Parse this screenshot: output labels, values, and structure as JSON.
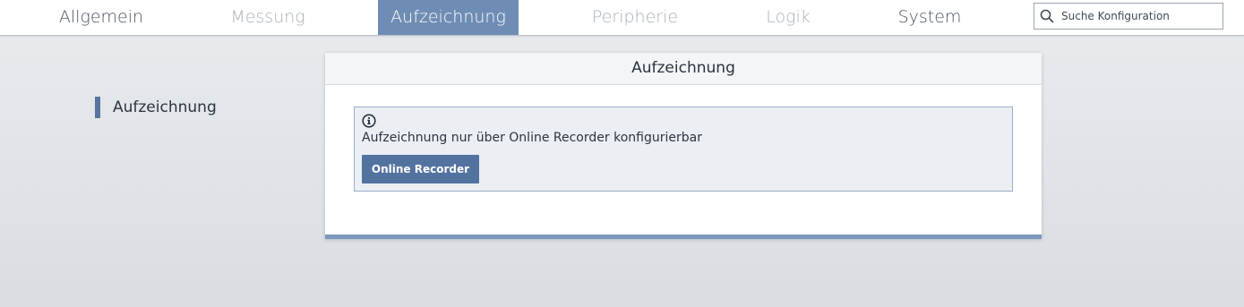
{
  "nav": {
    "tabs": [
      {
        "label": "Allgemein",
        "state": "normal"
      },
      {
        "label": "Messung",
        "state": "dim"
      },
      {
        "label": "Aufzeichnung",
        "state": "active"
      },
      {
        "label": "Peripherie",
        "state": "dim"
      },
      {
        "label": "Logik",
        "state": "dim"
      },
      {
        "label": "System",
        "state": "normal"
      }
    ],
    "search": {
      "placeholder": "Suche Konfiguration",
      "value": "",
      "icon": "search-icon"
    }
  },
  "sidebar": {
    "items": [
      {
        "label": "Aufzeichnung",
        "active": true
      }
    ]
  },
  "panel": {
    "title": "Aufzeichnung",
    "info": {
      "icon": "info-icon",
      "text": "Aufzeichnung nur über Online Recorder konfigurierbar",
      "button_label": "Online Recorder"
    }
  },
  "colors": {
    "accent": "#6f8db4",
    "button": "#5273a0",
    "info_bg": "#ebeff4",
    "info_border": "#9aaec8"
  }
}
